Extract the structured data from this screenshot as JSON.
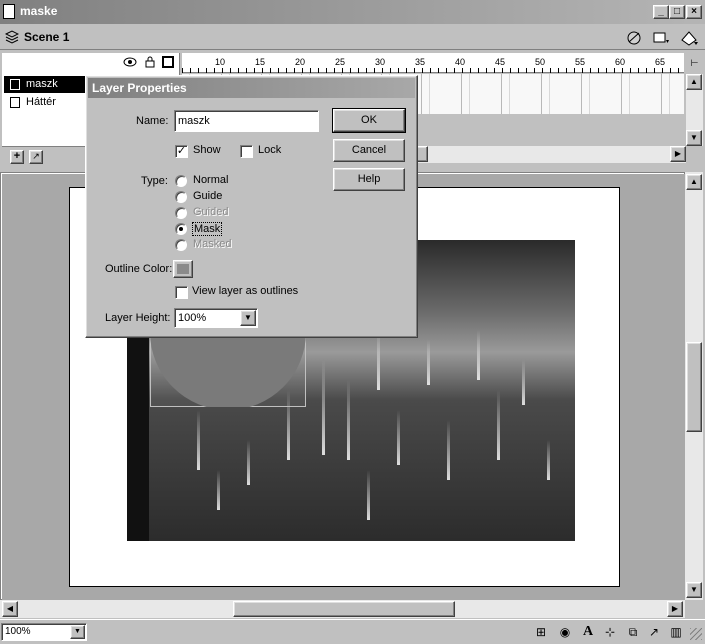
{
  "window": {
    "title": "maske"
  },
  "scene": {
    "label": "Scene 1"
  },
  "timeline": {
    "layers": [
      {
        "name": "maszk",
        "selected": true
      },
      {
        "name": "Háttér",
        "selected": false
      }
    ],
    "ruler_ticks": [
      "10",
      "15",
      "20",
      "25",
      "30",
      "35",
      "40",
      "45",
      "50",
      "55",
      "60",
      "65"
    ]
  },
  "dialog": {
    "title": "Layer Properties",
    "name_label": "Name:",
    "name_value": "maszk",
    "show_label": "Show",
    "show_checked": true,
    "lock_label": "Lock",
    "lock_checked": false,
    "type_label": "Type:",
    "types": [
      {
        "label": "Normal",
        "selected": false,
        "disabled": false
      },
      {
        "label": "Guide",
        "selected": false,
        "disabled": false
      },
      {
        "label": "Guided",
        "selected": false,
        "disabled": true
      },
      {
        "label": "Mask",
        "selected": true,
        "disabled": false
      },
      {
        "label": "Masked",
        "selected": false,
        "disabled": true
      }
    ],
    "outline_color_label": "Outline Color:",
    "outline_color": "#8a8a8a",
    "outlines_label": "View layer as outlines",
    "outlines_checked": false,
    "layer_height_label": "Layer Height:",
    "layer_height_value": "100%",
    "ok_label": "OK",
    "cancel_label": "Cancel",
    "help_label": "Help"
  },
  "status": {
    "zoom_value": "100%"
  },
  "colors": {
    "mask_fill": "#7a7a7a",
    "titlebar": "#808080"
  }
}
